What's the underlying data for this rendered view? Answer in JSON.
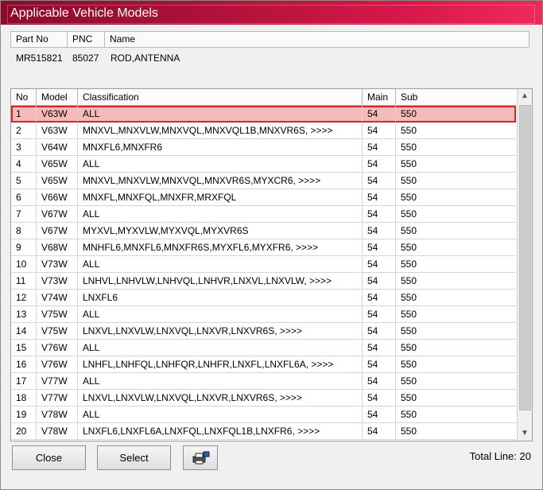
{
  "window": {
    "title": "Applicable Vehicle Models"
  },
  "part_info": {
    "headers": [
      "Part No",
      "PNC",
      "Name"
    ],
    "values": [
      "MR515821",
      "85027",
      "ROD,ANTENNA"
    ]
  },
  "table": {
    "columns": [
      "No",
      "Model",
      "Classification",
      "Main",
      "Sub"
    ],
    "selected_row_index": 0,
    "rows": [
      [
        "1",
        "V63W",
        "ALL",
        "54",
        "550"
      ],
      [
        "2",
        "V63W",
        "MNXVL,MNXVLW,MNXVQL,MNXVQL1B,MNXVR6S,  >>>>",
        "54",
        "550"
      ],
      [
        "3",
        "V64W",
        "MNXFL6,MNXFR6",
        "54",
        "550"
      ],
      [
        "4",
        "V65W",
        "ALL",
        "54",
        "550"
      ],
      [
        "5",
        "V65W",
        "MNXVL,MNXVLW,MNXVQL,MNXVR6S,MYXCR6,  >>>>",
        "54",
        "550"
      ],
      [
        "6",
        "V66W",
        "MNXFL,MNXFQL,MNXFR,MRXFQL",
        "54",
        "550"
      ],
      [
        "7",
        "V67W",
        "ALL",
        "54",
        "550"
      ],
      [
        "8",
        "V67W",
        "MYXVL,MYXVLW,MYXVQL,MYXVR6S",
        "54",
        "550"
      ],
      [
        "9",
        "V68W",
        "MNHFL6,MNXFL6,MNXFR6S,MYXFL6,MYXFR6,  >>>>",
        "54",
        "550"
      ],
      [
        "10",
        "V73W",
        "ALL",
        "54",
        "550"
      ],
      [
        "11",
        "V73W",
        "LNHVL,LNHVLW,LNHVQL,LNHVR,LNXVL,LNXVLW,  >>>>",
        "54",
        "550"
      ],
      [
        "12",
        "V74W",
        "LNXFL6",
        "54",
        "550"
      ],
      [
        "13",
        "V75W",
        "ALL",
        "54",
        "550"
      ],
      [
        "14",
        "V75W",
        "LNXVL,LNXVLW,LNXVQL,LNXVR,LNXVR6S,  >>>>",
        "54",
        "550"
      ],
      [
        "15",
        "V76W",
        "ALL",
        "54",
        "550"
      ],
      [
        "16",
        "V76W",
        "LNHFL,LNHFQL,LNHFQR,LNHFR,LNXFL,LNXFL6A,  >>>>",
        "54",
        "550"
      ],
      [
        "17",
        "V77W",
        "ALL",
        "54",
        "550"
      ],
      [
        "18",
        "V77W",
        "LNXVL,LNXVLW,LNXVQL,LNXVR,LNXVR6S,  >>>>",
        "54",
        "550"
      ],
      [
        "19",
        "V78W",
        "ALL",
        "54",
        "550"
      ],
      [
        "20",
        "V78W",
        "LNXFL6,LNXFL6A,LNXFQL,LNXFQL1B,LNXFR6,  >>>>",
        "54",
        "550"
      ]
    ]
  },
  "buttons": {
    "close": "Close",
    "select": "Select",
    "print_icon": "printer-icon"
  },
  "footer": {
    "total_line": "Total Line: 20"
  },
  "colors": {
    "title_gradient_start": "#8c0a2c",
    "title_gradient_end": "#ee2a5c",
    "selected_row": "#f8b9b9",
    "selected_border": "#cc2a2a"
  }
}
